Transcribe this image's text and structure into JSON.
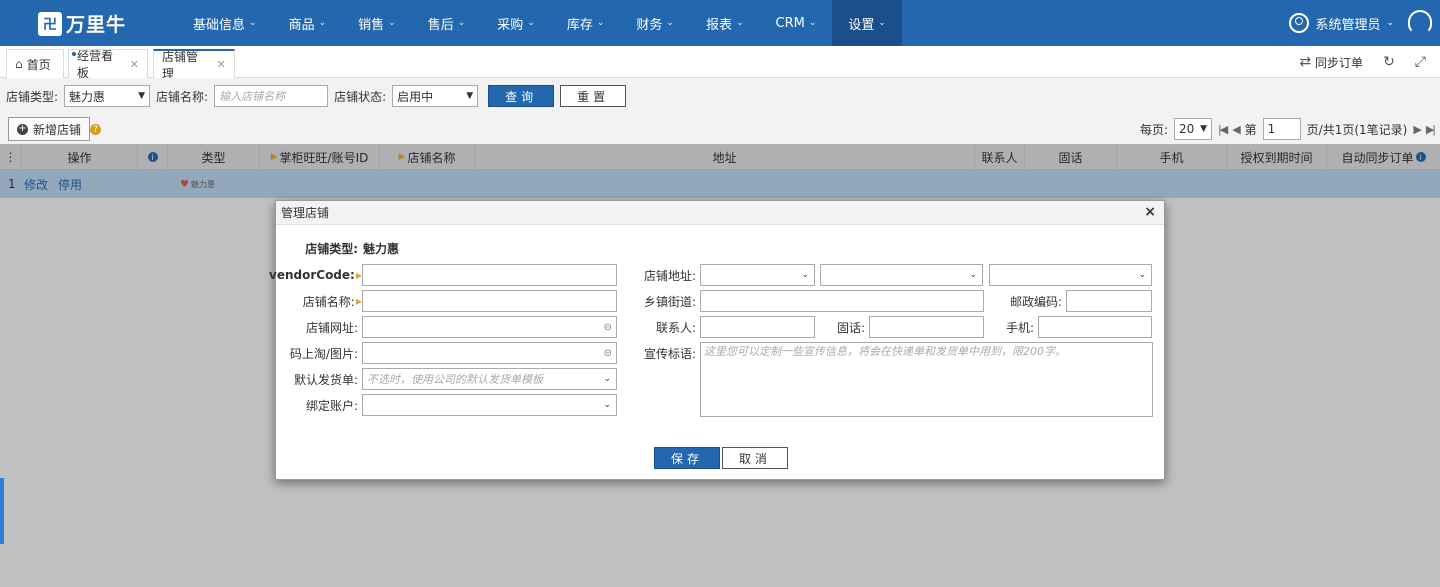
{
  "app": {
    "logo_text": "万里牛",
    "logo_mark": "卐"
  },
  "nav": {
    "items": [
      {
        "label": "基础信息"
      },
      {
        "label": "商品"
      },
      {
        "label": "销售"
      },
      {
        "label": "售后"
      },
      {
        "label": "采购"
      },
      {
        "label": "库存"
      },
      {
        "label": "财务"
      },
      {
        "label": "报表"
      },
      {
        "label": "CRM"
      },
      {
        "label": "设置"
      }
    ],
    "active": "设置",
    "user": "系统管理员"
  },
  "tabs": {
    "items": [
      {
        "label": "首页"
      },
      {
        "label": "经营看板"
      },
      {
        "label": "店铺管理"
      }
    ],
    "sync_orders": "同步订单"
  },
  "filter": {
    "shop_type_label": "店铺类型:",
    "shop_type_value": "魅力惠",
    "shop_name_label": "店铺名称:",
    "shop_name_placeholder": "输入店铺名称",
    "shop_status_label": "店铺状态:",
    "shop_status_value": "启用中",
    "query": "查询",
    "reset": "重置"
  },
  "toolbar": {
    "add_shop": "新增店铺",
    "per_page_label": "每页:",
    "per_page": "20",
    "page_prefix": "第",
    "page_value": "1",
    "page_suffix": "页/共1页(1笔记录)"
  },
  "grid": {
    "columns": [
      "操作",
      "类型",
      "掌柜旺旺/账号ID",
      "店铺名称",
      "地址",
      "联系人",
      "固话",
      "手机",
      "授权到期时间",
      "自动同步订单"
    ],
    "rows": [
      {
        "index": "1",
        "edit": "修改",
        "disable": "停用",
        "type": "魅力惠"
      }
    ]
  },
  "dialog": {
    "title": "管理店铺",
    "shop_type_label": "店铺类型:",
    "shop_type_value": "魅力惠",
    "vendor_code_label": "vendorCode:",
    "shop_name_label": "店铺名称:",
    "shop_url_label": "店铺网址:",
    "qr_label": "码上淘/图片:",
    "default_ship_label": "默认发货单:",
    "default_ship_placeholder": "不选时，使用公司的默认发货单模板",
    "bind_account_label": "绑定账户:",
    "address_label": "店铺地址:",
    "street_label": "乡镇街道:",
    "postcode_label": "邮政编码:",
    "contact_label": "联系人:",
    "phone_label": "固话:",
    "mobile_label": "手机:",
    "slogan_label": "宣传标语:",
    "slogan_placeholder": "这里您可以定制一些宣传信息，将会在快递单和发货单中用到，限200字。",
    "save": "保存",
    "cancel": "取消"
  }
}
